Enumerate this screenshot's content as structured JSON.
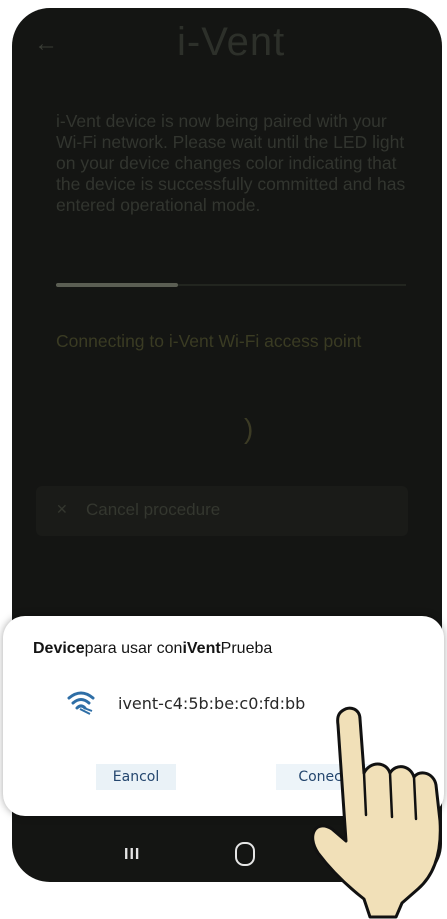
{
  "app": {
    "logo": "i-Vent"
  },
  "pairing": {
    "description": "i-Vent device is now being paired with your Wi-Fi network. Please wait until the LED light on your device changes color indicating that the device is successfully committed and has entered operational mode.",
    "progress_fraction": 0.35,
    "status": "Connecting to i-Vent Wi-Fi access point",
    "spinner_glyph": ")",
    "cancel_label": "Cancel procedure"
  },
  "dialog": {
    "title_part1": "Device",
    "title_part2": "para usar con",
    "title_part3": "iVent",
    "title_part4": "Prueba",
    "network_name": "ivent-c4:5b:be:c0:fd:bb",
    "cancel_label": "Eancol",
    "connect_label": "Conectar"
  },
  "navbar": {
    "recent_glyph": "III"
  },
  "colors": {
    "wifi_icon": "#2e6ea6",
    "hand_fill": "#f1e0b8",
    "hand_outline": "#111111"
  }
}
